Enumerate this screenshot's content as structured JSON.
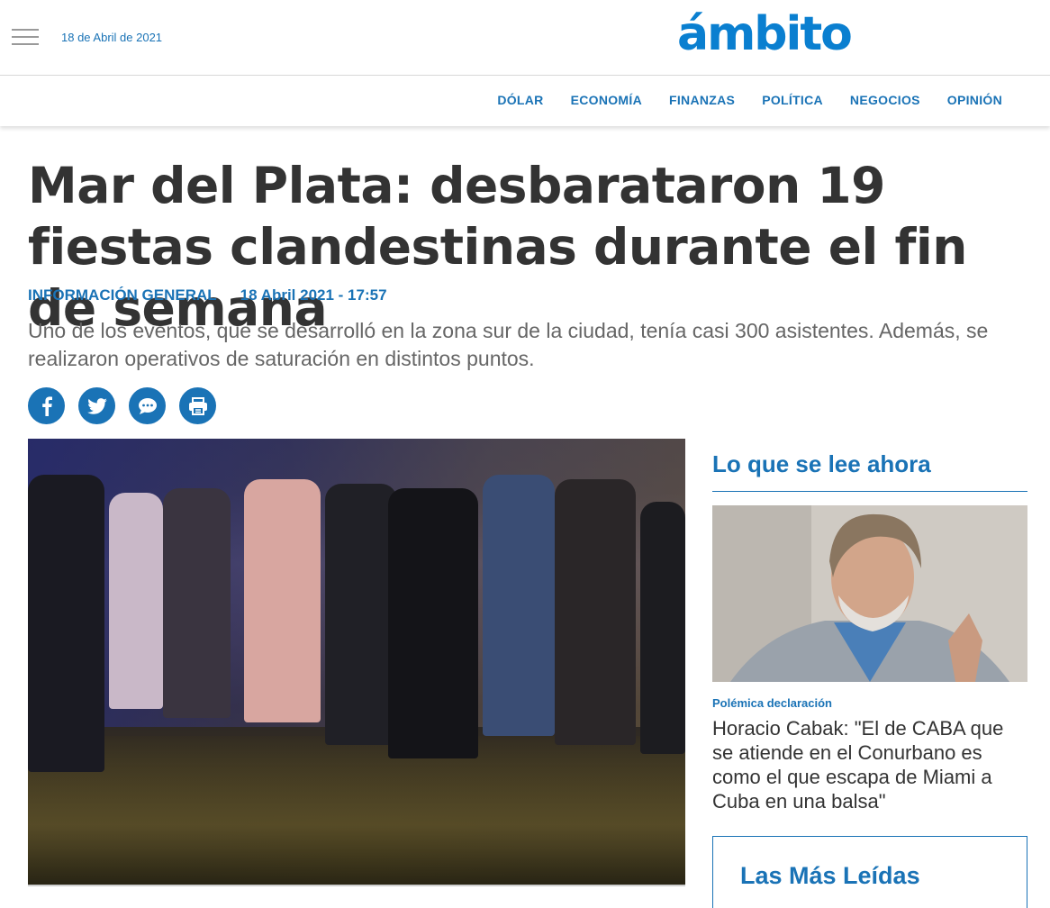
{
  "header": {
    "date": "18 de Abril de 2021",
    "logo": "ámbito",
    "brand_color": "#0a7fd0"
  },
  "nav": {
    "items": [
      "DÓLAR",
      "ECONOMÍA",
      "FINANZAS",
      "POLÍTICA",
      "NEGOCIOS",
      "OPINIÓN"
    ]
  },
  "article": {
    "title": "Mar del Plata: desbarataron 19 fiestas clandestinas durante el fin de semana",
    "section": "INFORMACIÓN GENERAL",
    "datetime": "18 Abril 2021 - 17:57",
    "lead": "Uno de los eventos, que se desarrolló en la zona sur de la ciudad, tenía casi 300 asistentes. Además, se realizaron operativos de saturación en distintos puntos.",
    "share": [
      "facebook-icon",
      "twitter-icon",
      "comment-icon",
      "print-icon"
    ]
  },
  "sidebar": {
    "title": "Lo que se lee ahora",
    "featured": {
      "kicker": "Polémica declaración",
      "headline": "Horacio Cabak: \"El de CABA que se atiende en el Conurbano es como el que escapa de Miami a Cuba en una balsa\""
    },
    "most_read_title": "Las Más Leídas"
  },
  "colors": {
    "accent": "#1a73b6",
    "text": "#333333",
    "muted": "#666666"
  }
}
